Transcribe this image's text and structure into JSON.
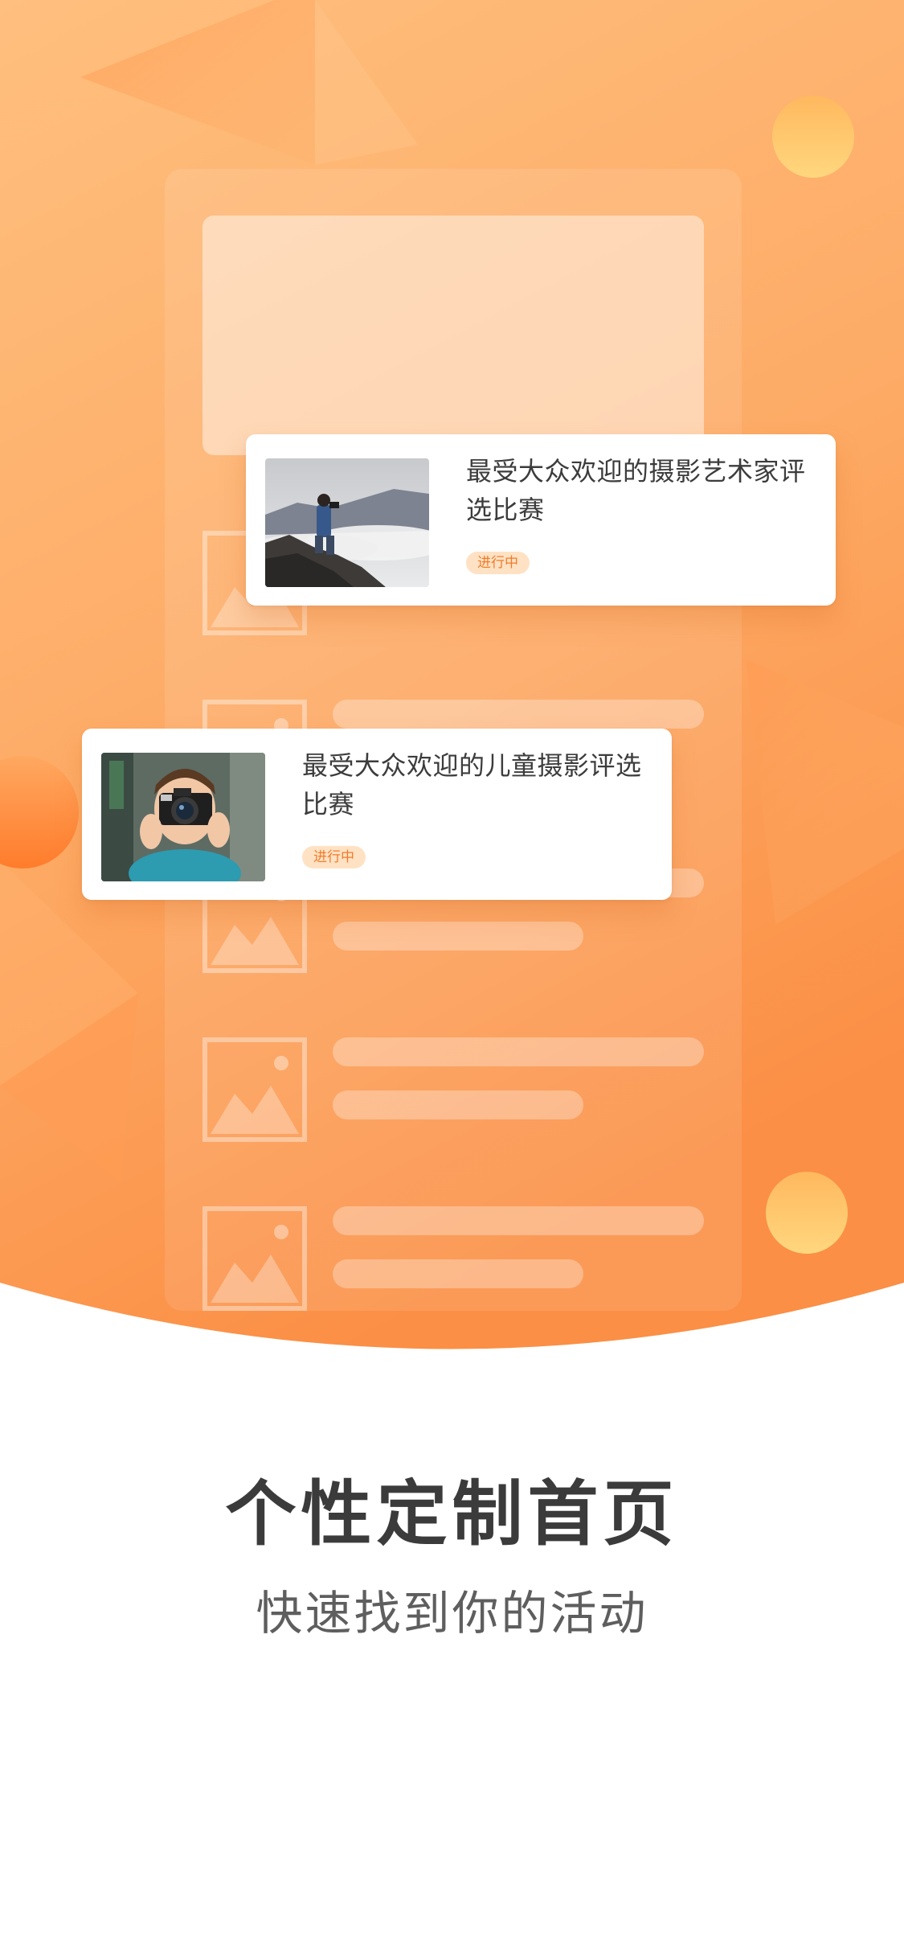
{
  "cards": [
    {
      "title": "最受大众欢迎的摄影艺术家评选比赛",
      "status": "进行中",
      "image_icon": "photographer-on-cliff-photo"
    },
    {
      "title": "最受大众欢迎的儿童摄影评选比赛",
      "status": "进行中",
      "image_icon": "child-with-camera-photo"
    }
  ],
  "headline": "个性定制首页",
  "subline": "快速找到你的活动",
  "colors": {
    "hero_top": "#ffc07a",
    "hero_bottom": "#fb8f45",
    "accent": "#f07c2c",
    "status_bg": "#ffe2c4",
    "title_text": "#3b3b3b"
  }
}
